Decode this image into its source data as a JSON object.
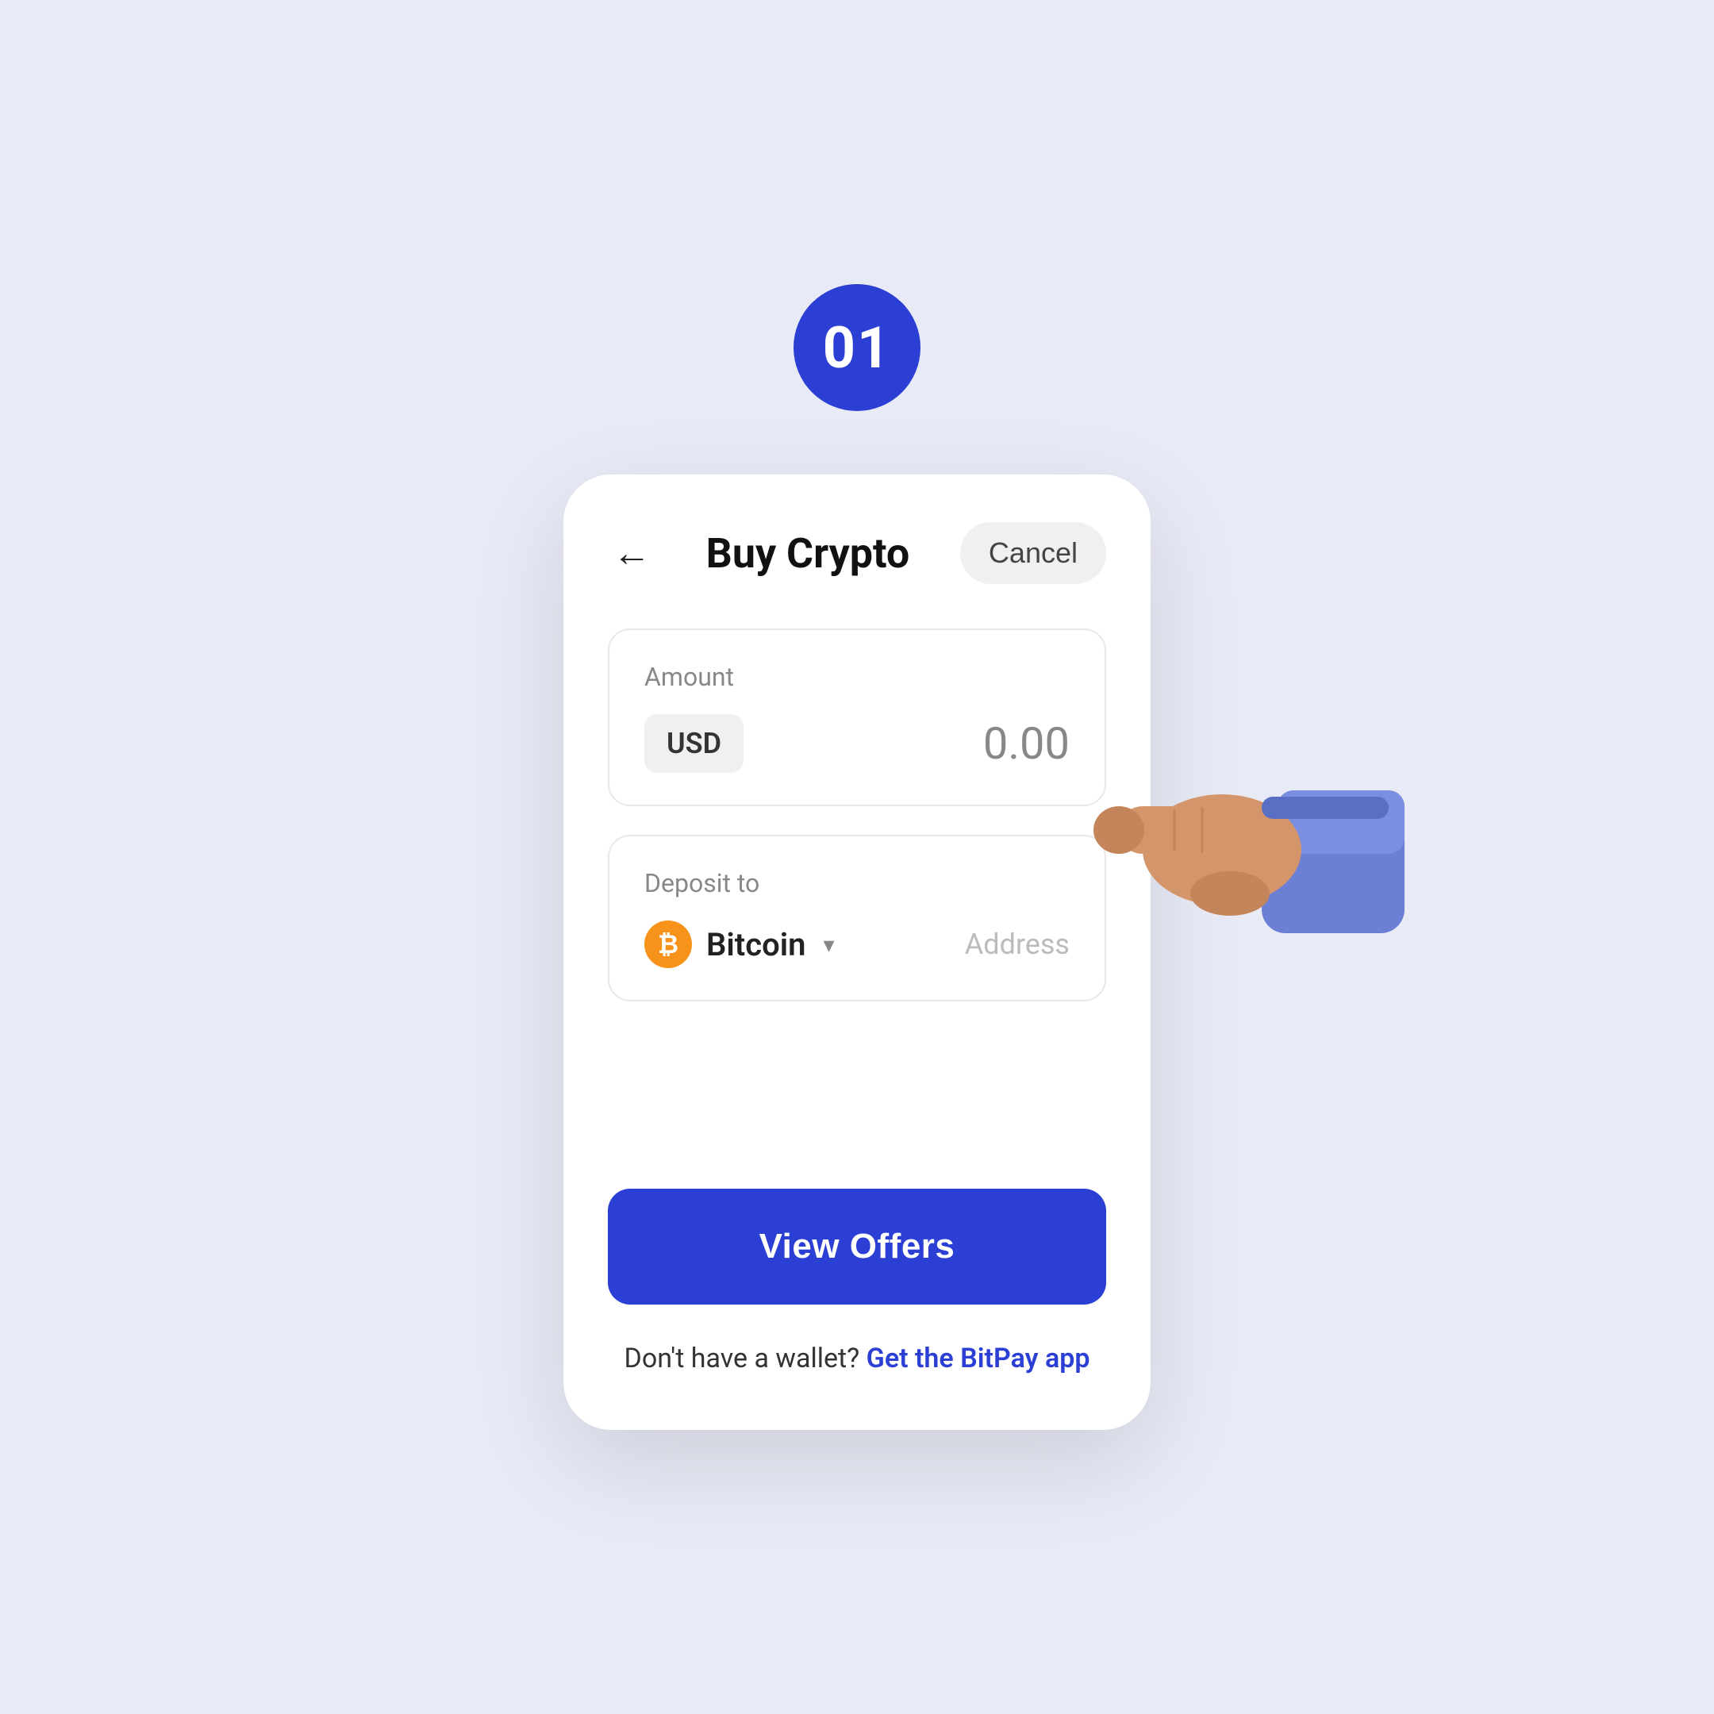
{
  "page": {
    "background_color": "#e8eaf6",
    "step_number": "01",
    "step_badge_color": "#2b3fd4"
  },
  "header": {
    "title": "Buy Crypto",
    "cancel_label": "Cancel",
    "back_icon": "←"
  },
  "amount_section": {
    "label": "Amount",
    "currency": "USD",
    "value": "0.00"
  },
  "deposit_section": {
    "label": "Deposit to",
    "crypto_name": "Bitcoin",
    "address_placeholder": "Address",
    "btc_symbol": "₿"
  },
  "actions": {
    "view_offers_label": "View Offers",
    "wallet_text_prefix": "Don't have a wallet?",
    "wallet_link_text": "Get the BitPay app"
  }
}
